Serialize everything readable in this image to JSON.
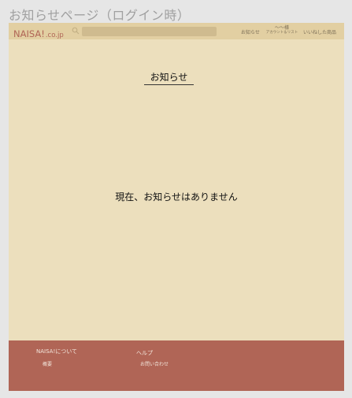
{
  "page_label": "お知らせページ（ログイン時）",
  "header": {
    "logo_main": "NAISA!",
    "logo_sub": ".co.jp",
    "search": {
      "icon": "search-icon",
      "placeholder": ""
    },
    "nav": {
      "news": "お知らせ",
      "user_name": "〜〜様",
      "account_label": "アカウント＆リスト",
      "likes": "いいねした商品"
    }
  },
  "main": {
    "title": "お知らせ",
    "empty_message": "現在、お知らせはありません"
  },
  "footer": {
    "about": {
      "heading": "NAISA!について",
      "links": [
        "概要"
      ]
    },
    "help": {
      "heading": "ヘルプ",
      "links": [
        "お問い合わせ"
      ]
    }
  },
  "colors": {
    "page_bg": "#e6e6e6",
    "frame_bg": "#ecdfbd",
    "header_bg": "#e2cfa2",
    "search_bg": "#cfbb8f",
    "brand": "#b06556",
    "footer_bg": "#b06556"
  }
}
